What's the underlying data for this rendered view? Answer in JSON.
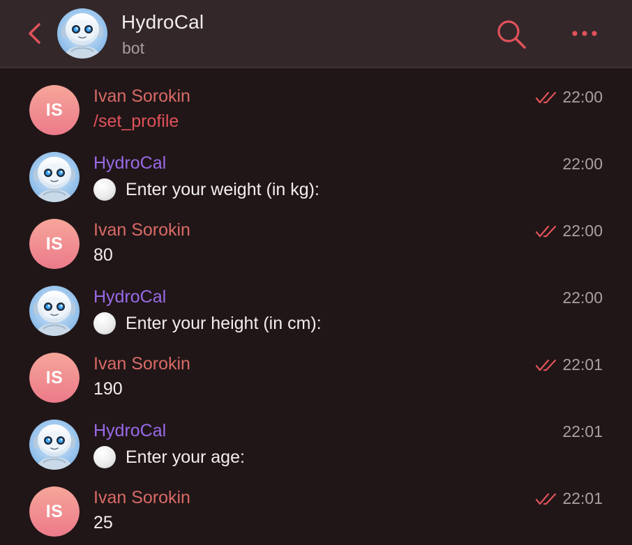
{
  "header": {
    "title": "HydroCal",
    "subtitle": "bot",
    "back_icon": "chevron-left-icon",
    "search_icon": "search-icon",
    "more_icon": "more-horizontal-icon"
  },
  "colors": {
    "accent": "#e0525a",
    "user_name": "#d96a66",
    "bot_name": "#9a6ae8",
    "background": "#201617",
    "header_bg": "#33272a"
  },
  "messages": [
    {
      "sender": "Ivan Sorokin",
      "type": "user",
      "initials": "IS",
      "text": "/set_profile",
      "time": "22:00",
      "read": true
    },
    {
      "sender": "HydroCal",
      "type": "bot",
      "text": "Enter your weight (in kg):",
      "time": "22:00"
    },
    {
      "sender": "Ivan Sorokin",
      "type": "user",
      "initials": "IS",
      "text": "80",
      "time": "22:00",
      "read": true
    },
    {
      "sender": "HydroCal",
      "type": "bot",
      "text": "Enter your height (in cm):",
      "time": "22:00"
    },
    {
      "sender": "Ivan Sorokin",
      "type": "user",
      "initials": "IS",
      "text": "190",
      "time": "22:01",
      "read": true
    },
    {
      "sender": "HydroCal",
      "type": "bot",
      "text": "Enter your age:",
      "time": "22:01"
    },
    {
      "sender": "Ivan Sorokin",
      "type": "user",
      "initials": "IS",
      "text": "25",
      "time": "22:01",
      "read": true
    }
  ]
}
